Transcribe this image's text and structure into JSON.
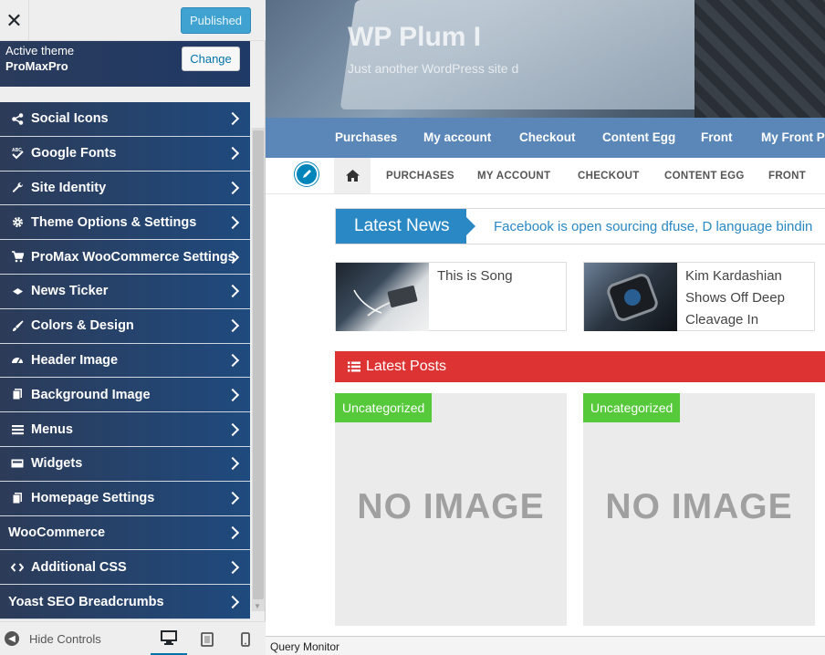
{
  "sidebar": {
    "publish_label": "Published",
    "active_theme_label": "Active theme",
    "theme_name": "ProMaxPro",
    "change_label": "Change",
    "items": [
      {
        "label": "Social Icons",
        "icon": "share-icon"
      },
      {
        "label": "Google Fonts",
        "icon": "font-abc-icon"
      },
      {
        "label": "Site Identity",
        "icon": "wrench-icon"
      },
      {
        "label": "Theme Options & Settings",
        "icon": "gear-icon"
      },
      {
        "label": "ProMax WooCommerce Settings",
        "icon": "cart-icon"
      },
      {
        "label": "News Ticker",
        "icon": "ticker-icon"
      },
      {
        "label": "Colors & Design",
        "icon": "brush-icon"
      },
      {
        "label": "Header Image",
        "icon": "gauge-icon"
      },
      {
        "label": "Background Image",
        "icon": "pages-icon"
      },
      {
        "label": "Menus",
        "icon": "menu-icon"
      },
      {
        "label": "Widgets",
        "icon": "widget-icon"
      },
      {
        "label": "Homepage Settings",
        "icon": "pages-icon"
      },
      {
        "label": "WooCommerce",
        "icon": ""
      },
      {
        "label": "Additional CSS",
        "icon": "code-icon"
      },
      {
        "label": "Yoast SEO Breadcrumbs",
        "icon": ""
      }
    ],
    "hide_controls_label": "Hide Controls"
  },
  "preview": {
    "site_title": "WP Plum I",
    "site_tagline": "Just another WordPress site d",
    "top_nav": [
      "Purchases",
      "My account",
      "Checkout",
      "Content Egg",
      "Front",
      "My Front P"
    ],
    "sec_nav": [
      "PURCHASES",
      "MY ACCOUNT",
      "CHECKOUT",
      "CONTENT EGG",
      "FRONT"
    ],
    "ticker_label": "Latest News",
    "ticker_text": "Facebook is open sourcing dfuse, D language bindin",
    "news": [
      {
        "title": "This is Song"
      },
      {
        "title_lines": [
          "Kim Kardashian",
          "Shows Off Deep",
          "Cleavage In"
        ]
      }
    ],
    "latest_posts_label": "Latest Posts",
    "posts": [
      {
        "category": "Uncategorized",
        "placeholder": "NO IMAGE"
      },
      {
        "category": "Uncategorized",
        "placeholder": "NO IMAGE"
      }
    ]
  },
  "query_monitor_label": "Query Monitor",
  "colors": {
    "menu_bg": "#2c3b58",
    "publish_bg": "#3fa2d1",
    "topnav_bg": "#5b87b8",
    "ticker_bg": "#2a88c4",
    "posts_bar_bg": "#dd3333",
    "category_bg": "#55c93a"
  }
}
